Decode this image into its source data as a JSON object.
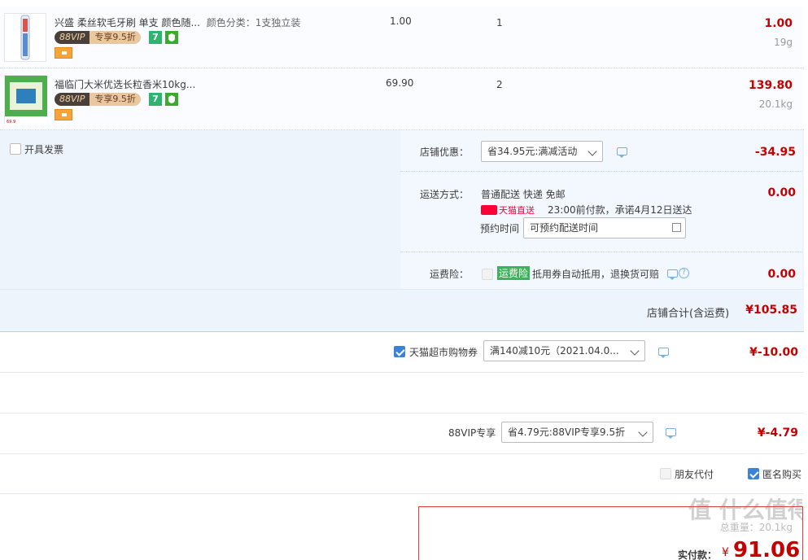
{
  "items": [
    {
      "title": "兴盛 柔丝软毛牙刷 单支 颜色随...",
      "sku": "颜色分类：1支独立装",
      "vip": "88VIP",
      "vip_discount": "专享9.5折",
      "badge7": "7",
      "unit_price": "1.00",
      "quantity": "1",
      "total": "1.00",
      "weight": "19g"
    },
    {
      "title": "福临门大米优选长粒香米10kg...",
      "sku": "",
      "vip": "88VIP",
      "vip_discount": "专享9.5折",
      "badge7": "7",
      "unit_price": "69.90",
      "quantity": "2",
      "total": "139.80",
      "weight": "20.1kg",
      "thumb_price": "69.9"
    }
  ],
  "invoice": {
    "label": "开具发票"
  },
  "shop_discount": {
    "label": "店铺优惠：",
    "selected": "省34.95元:满减活动",
    "amount": "-34.95"
  },
  "shipping": {
    "label": "运送方式：",
    "method": "普通配送 快递 免邮",
    "tmall_tag": "天猫直送",
    "promise": "23:00前付款，承诺4月12日送达",
    "reserve_label": "预约时间",
    "reserve_placeholder": "可预约配送时间",
    "amount": "0.00"
  },
  "insurance": {
    "label": "运费险：",
    "tag": "运费险",
    "desc": "抵用券自动抵用，退换货可赔",
    "amount": "0.00"
  },
  "shop_total": {
    "label": "店铺合计(含运费)",
    "value": "¥105.85"
  },
  "coupon": {
    "label": "天猫超市购物券",
    "selected": "满140减10元（2021.04.0...",
    "amount": "¥-10.00"
  },
  "vip_row": {
    "label": "88VIP专享",
    "selected": "省4.79元:88VIP专享9.5折",
    "amount": "¥-4.79"
  },
  "options": {
    "friend_pay": "朋友代付",
    "anonymous": "匿名购买"
  },
  "summary": {
    "weight_label": "总重量：20.1kg",
    "pay_label": "实付款：",
    "currency": "¥",
    "pay_value": "91.06"
  },
  "watermark": "值 什么值得买",
  "colors": {
    "accent": "#c40000",
    "panel": "#edf4fc",
    "checkbox": "#3a83d8",
    "tmall": "#ff0036"
  }
}
